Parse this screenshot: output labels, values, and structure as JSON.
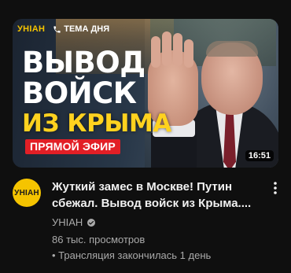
{
  "thumbnail": {
    "brand_logo": "УНІАН",
    "topic_label": "ТЕМА ДНЯ",
    "headline_line1": "ВЫВОД",
    "headline_line2": "ВОЙСК",
    "headline_line3": "ИЗ КРЫМА",
    "live_badge": "ПРЯМОЙ ЭФИР",
    "duration": "16:51",
    "icons": {
      "topic": "phone-icon"
    },
    "colors": {
      "brand": "#f5c400",
      "highlight": "#ffd21f",
      "badge": "#e21f26"
    }
  },
  "video": {
    "title_line1": "Жуткий замес в Москве! Путин",
    "title_line2": "сбежал. Вывод войск из Крыма....",
    "channel_name": "УНІАН",
    "views": "86 тыс. просмотров",
    "streamed": "• Трансляция закончилась 1 день"
  },
  "channel_avatar_text": "УНІАН",
  "icons": {
    "verified": "verified-icon",
    "more": "more-vert-icon"
  },
  "colors": {
    "background": "#0f0f0f",
    "text_primary": "#f1f1f1",
    "text_secondary": "#aaaaaa"
  }
}
